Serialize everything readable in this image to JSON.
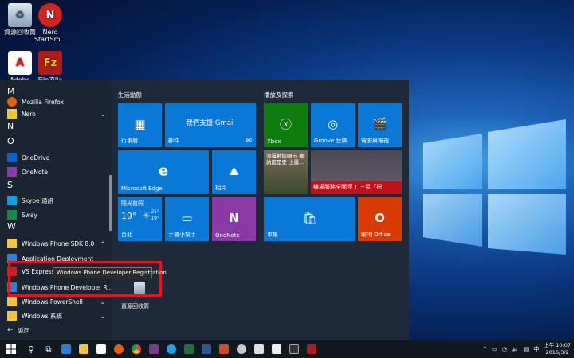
{
  "desktop": {
    "icons": [
      {
        "label": "資源回收筒"
      },
      {
        "label": "Nero StartSm..."
      },
      {
        "label": "Adobe"
      },
      {
        "label": "FileZilla"
      }
    ]
  },
  "start_menu": {
    "app_list": {
      "rows": [
        {
          "label": "Mozilla Firefox"
        },
        {
          "label": "Nero"
        },
        {
          "label": "OneDrive"
        },
        {
          "label": "OneNote"
        },
        {
          "label": "Skype 通訊"
        },
        {
          "label": "Sway"
        },
        {
          "label": "Windows Phone SDK 8.0"
        },
        {
          "label": "Application Deployment"
        },
        {
          "label": "VS Express"
        },
        {
          "label": "Windows Phone Developer R..."
        },
        {
          "label": "Windows PowerShell"
        },
        {
          "label": "Windows 系統"
        }
      ],
      "letters": [
        "M",
        "N",
        "O",
        "S",
        "W"
      ],
      "back_label": "返回"
    },
    "tooltip": "Windows Phone Developer Registration",
    "groups": {
      "left": "生活動態",
      "right": "播放及探索"
    },
    "tiles": {
      "calendar": "行事曆",
      "mail_title": "我們支援 Gmail",
      "mail": "郵件",
      "edge": "Microsoft Edge",
      "photos": "相片",
      "weather_title": "陽光普照",
      "weather_temp": "19°",
      "weather_hi": "25°",
      "weather_lo": "19°",
      "weather_city": "台北",
      "phone": "手機小幫手",
      "onenote": "OneNote",
      "recycle": "資源回收筒",
      "xbox": "Xbox",
      "groove": "Groove 音樂",
      "movies": "電影與電視",
      "news_text": "洩露數據顯示 羅納度是史 上最...",
      "news_headline": "機場服務全面停工 三星「扮",
      "store": "市集",
      "office": "取得 Office"
    }
  },
  "taskbar": {
    "apps": [
      "windows-start-icon",
      "search-icon",
      "task-view-icon",
      "edge-icon",
      "file-explorer-icon",
      "store-icon",
      "firefox-icon",
      "chrome-icon",
      "winrar-icon",
      "ie-icon",
      "excel-icon",
      "word-icon",
      "powerpoint-icon",
      "settings-icon",
      "calculator-icon",
      "paint-icon",
      "cmd-icon",
      "filezilla-icon"
    ],
    "ime": "中",
    "time": "上午 10:07",
    "date": "2016/3/2"
  }
}
